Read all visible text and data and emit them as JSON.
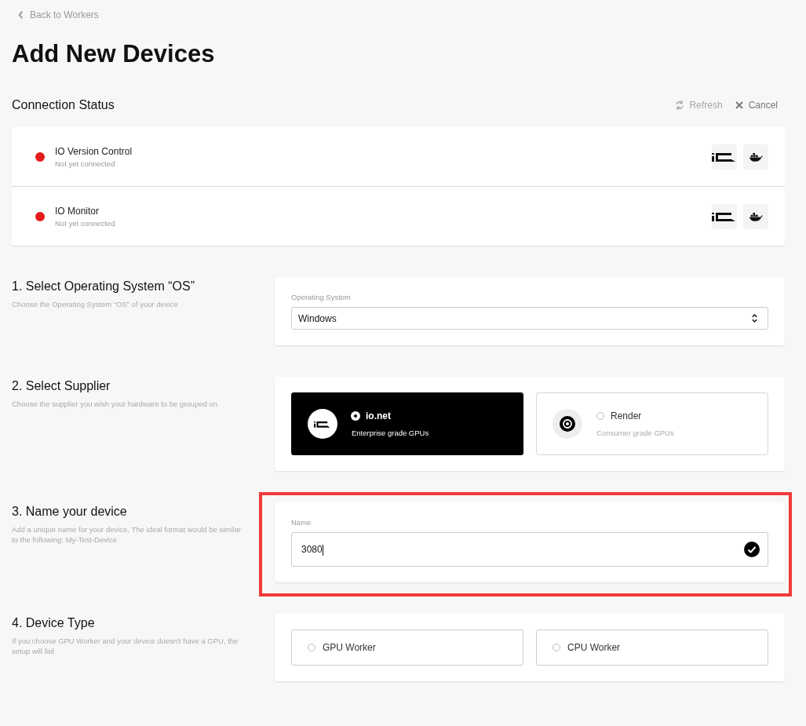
{
  "back_link": "Back to Workers",
  "title": "Add New Devices",
  "connection": {
    "heading": "Connection Status",
    "actions": [
      {
        "kind": "refresh",
        "label": "Refresh",
        "disabled": true
      },
      {
        "kind": "cancel",
        "label": "Cancel",
        "disabled": false
      }
    ],
    "items": [
      {
        "name": "IO Version Control",
        "status": "Not yet connected",
        "color": "#e31b1b"
      },
      {
        "name": "IO Monitor",
        "status": "Not yet connected",
        "color": "#e31b1b"
      }
    ]
  },
  "sections": [
    {
      "kind": "select",
      "title": "1. Select Operating System “OS”",
      "description": "Choose the Operating System “OS” of your device",
      "highlighted": false,
      "field_label": "Operating System",
      "value": "Windows"
    },
    {
      "kind": "supplier",
      "title": "2. Select Supplier",
      "description": "Choose the supplier you wish your hardware to be grouped on",
      "highlighted": false,
      "options": [
        {
          "kind": "io",
          "label": "io.net",
          "caption": "Enterprise grade GPUs",
          "selected": true
        },
        {
          "kind": "render",
          "label": "Render",
          "caption": "Consumer grade GPUs",
          "selected": false
        }
      ]
    },
    {
      "kind": "text",
      "title": "3. Name your device",
      "description": "Add a unique name for your device, The ideal format would be similar to the following: My-Test-Device",
      "highlighted": true,
      "field_label": "Name",
      "value": "3080",
      "valid": true
    },
    {
      "kind": "device_type",
      "title": "4. Device Type",
      "description": "If you choose GPU Worker and your device doesn't have a GPU, the setup will fail",
      "highlighted": false,
      "options": [
        {
          "label": "GPU Worker",
          "selected": false
        },
        {
          "label": "CPU Worker",
          "selected": false
        }
      ]
    }
  ]
}
